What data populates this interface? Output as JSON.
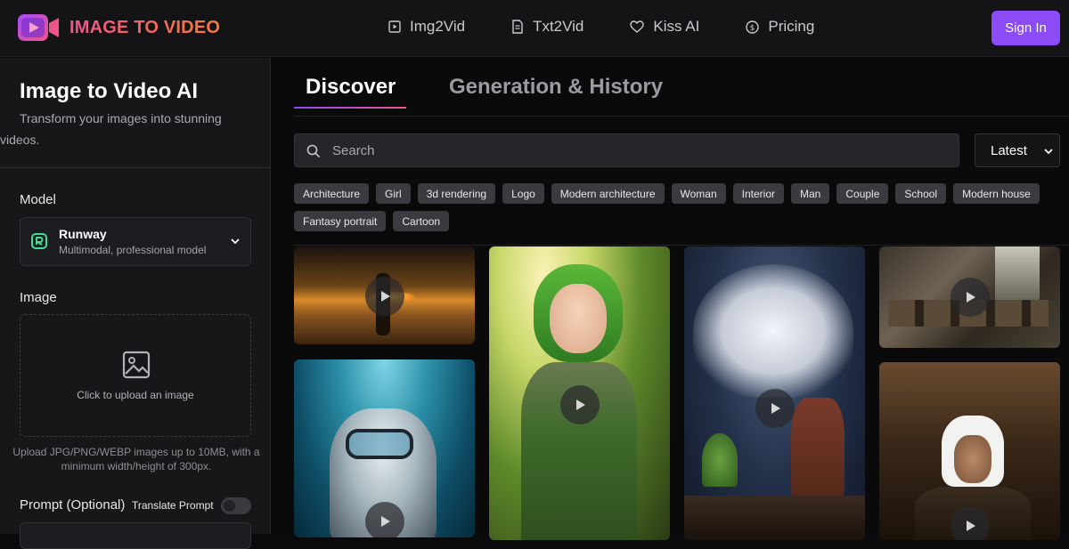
{
  "brand": {
    "name": "IMAGE TO VIDEO",
    "logo_icon": "video-camera-gradient-icon"
  },
  "nav": [
    {
      "label": "Img2Vid",
      "icon": "play-square-icon"
    },
    {
      "label": "Txt2Vid",
      "icon": "document-icon"
    },
    {
      "label": "Kiss AI",
      "icon": "heart-icon"
    },
    {
      "label": "Pricing",
      "icon": "dollar-circle-icon"
    }
  ],
  "header": {
    "signin_label": "Sign In"
  },
  "sidebar": {
    "title": "Image to Video AI",
    "description": "Transform your images into stunning videos.",
    "model_label": "Model",
    "model": {
      "name": "Runway",
      "subtitle": "Multimodal, professional model"
    },
    "image_label": "Image",
    "upload_text": "Click to upload an image",
    "upload_hint": "Upload JPG/PNG/WEBP images up to 10MB, with a minimum width/height of 300px.",
    "prompt_label": "Prompt (Optional)",
    "translate_label": "Translate Prompt",
    "translate_enabled": false
  },
  "main": {
    "tabs": [
      {
        "label": "Discover",
        "active": true
      },
      {
        "label": "Generation & History",
        "active": false
      }
    ],
    "search_placeholder": "Search",
    "sort_value": "Latest",
    "tags": [
      "Architecture",
      "Girl",
      "3d rendering",
      "Logo",
      "Modern architecture",
      "Woman",
      "Interior",
      "Man",
      "Couple",
      "School",
      "Modern house",
      "Fantasy portrait",
      "Cartoon"
    ]
  },
  "colors": {
    "accent": "#8b4cf6",
    "brand_gradient_start": "#f0548a",
    "brand_gradient_end": "#f77a3a"
  }
}
